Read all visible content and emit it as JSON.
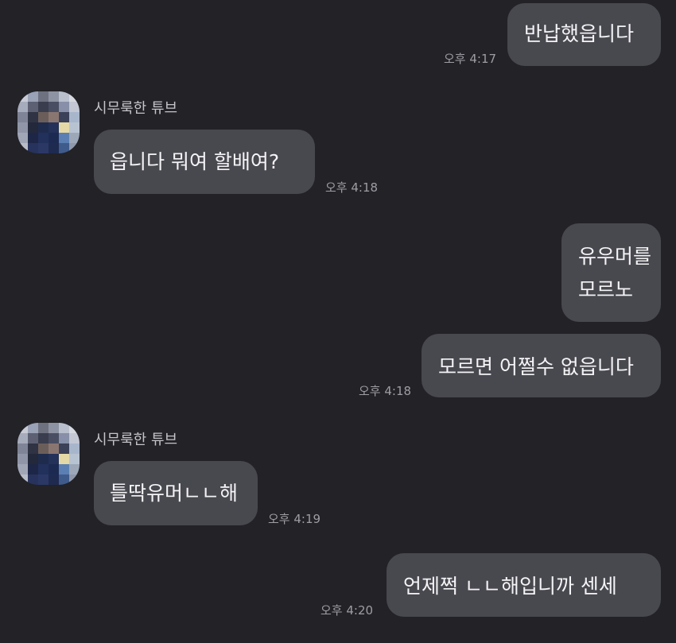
{
  "messages": [
    {
      "side": "right",
      "text": "반납했읍니다",
      "time": "오후 4:17"
    },
    {
      "side": "left",
      "sender": "시무룩한 튜브",
      "avatar_icon": "pixelated-profile-avatar",
      "text": "읍니다 뭐여 할배여?",
      "time": "오후 4:18"
    },
    {
      "side": "right",
      "lines": [
        "유우머를",
        "모르노"
      ]
    },
    {
      "side": "right",
      "text": "모르면 어쩔수 없읍니다",
      "time": "오후 4:18"
    },
    {
      "side": "left",
      "sender": "시무룩한 튜브",
      "avatar_icon": "pixelated-profile-avatar",
      "text": "틀딱유머ㄴㄴ해",
      "time": "오후 4:19"
    },
    {
      "side": "right",
      "text": "언제쩍 ㄴㄴ해입니까 센세",
      "time": "오후 4:20"
    }
  ],
  "colors": {
    "background": "#222227",
    "bubble": "#48484f",
    "bubble_text": "#f4f4f6",
    "time_text": "#9d9da3",
    "sender_text": "#c4c4c9"
  }
}
